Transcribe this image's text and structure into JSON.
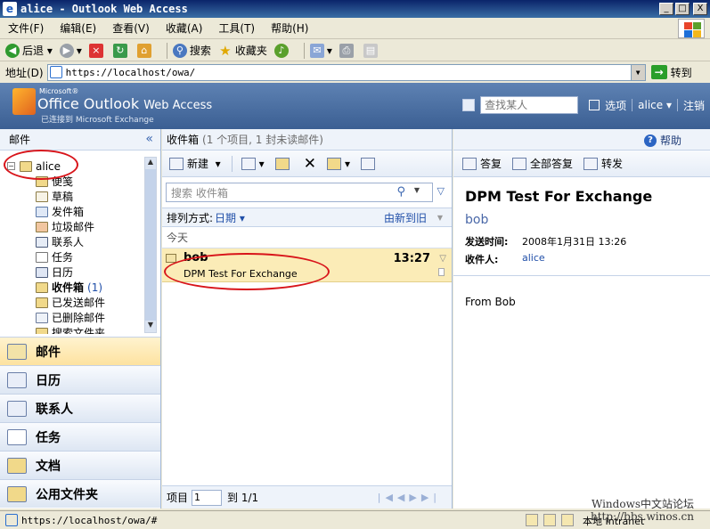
{
  "window": {
    "title": "alice - Outlook Web Access",
    "min": "_",
    "max": "□",
    "close": "X"
  },
  "menubar": {
    "items": [
      "文件(F)",
      "编辑(E)",
      "查看(V)",
      "收藏(A)",
      "工具(T)",
      "帮助(H)"
    ]
  },
  "ie_toolbar": {
    "back": "后退",
    "search": "搜索",
    "favorites": "收藏夹"
  },
  "addressbar": {
    "label": "地址(D)",
    "url": "https://localhost/owa/",
    "go": "转到"
  },
  "owa_header": {
    "ms": "Microsoft®",
    "brand": "Office Outlook",
    "brand_suffix": "Web Access",
    "subtitle": "已连接到 Microsoft Exchange",
    "find_placeholder": "查找某人",
    "options": "选项",
    "user": "alice",
    "logout": "注销"
  },
  "nav": {
    "header": "邮件",
    "collapse": "«",
    "mailbox": "alice",
    "folders": [
      {
        "name": "便笺"
      },
      {
        "name": "草稿"
      },
      {
        "name": "发件箱"
      },
      {
        "name": "垃圾邮件"
      },
      {
        "name": "联系人"
      },
      {
        "name": "任务"
      },
      {
        "name": "日历"
      },
      {
        "name": "收件箱",
        "count": "(1)"
      },
      {
        "name": "已发送邮件"
      },
      {
        "name": "已删除邮件"
      },
      {
        "name": "搜索文件夹"
      }
    ],
    "modules": [
      "邮件",
      "日历",
      "联系人",
      "任务",
      "文档",
      "公用文件夹"
    ]
  },
  "list": {
    "title": "收件箱",
    "subtitle": "(1 个项目, 1 封未读邮件)",
    "new_label": "新建",
    "search_placeholder": "搜索 收件箱",
    "sort_label": "排列方式:",
    "sort_field": "日期",
    "sort_order": "由新到旧",
    "group": "今天",
    "messages": [
      {
        "sender": "bob",
        "time": "13:27",
        "subject": "DPM Test For Exchange"
      }
    ],
    "pager_label": "项目",
    "page_value": "1",
    "page_range": "到 1/1"
  },
  "reader": {
    "help": "帮助",
    "reply": "答复",
    "reply_all": "全部答复",
    "forward": "转发",
    "subject": "DPM Test For Exchange",
    "from": "bob",
    "sent_label": "发送时间:",
    "sent_value": "2008年1月31日 13:26",
    "to_label": "收件人:",
    "to_value": "alice",
    "body": "From Bob"
  },
  "statusbar": {
    "url": "https://localhost/owa/#",
    "zone": "本地 Intranet"
  },
  "watermark": {
    "line1": "Windows中文站论坛",
    "line2": "http://bbs.winos.cn"
  }
}
